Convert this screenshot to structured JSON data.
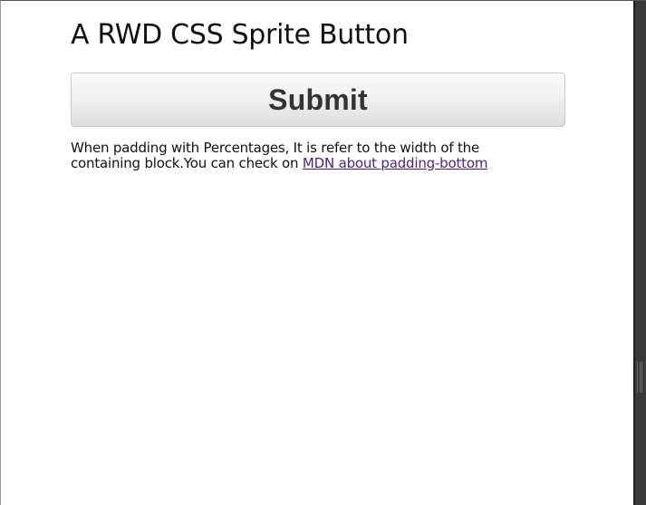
{
  "page": {
    "title": "A RWD CSS Sprite Button"
  },
  "button": {
    "label": "Submit"
  },
  "description": {
    "text": "When padding with Percentages, It is refer to the width of the containing block.You can check on ",
    "link_text": "MDN about padding-bottom"
  },
  "colors": {
    "link": "#4b1f86",
    "button_text": "#333333",
    "right_gutter": "#3a3a3a"
  }
}
